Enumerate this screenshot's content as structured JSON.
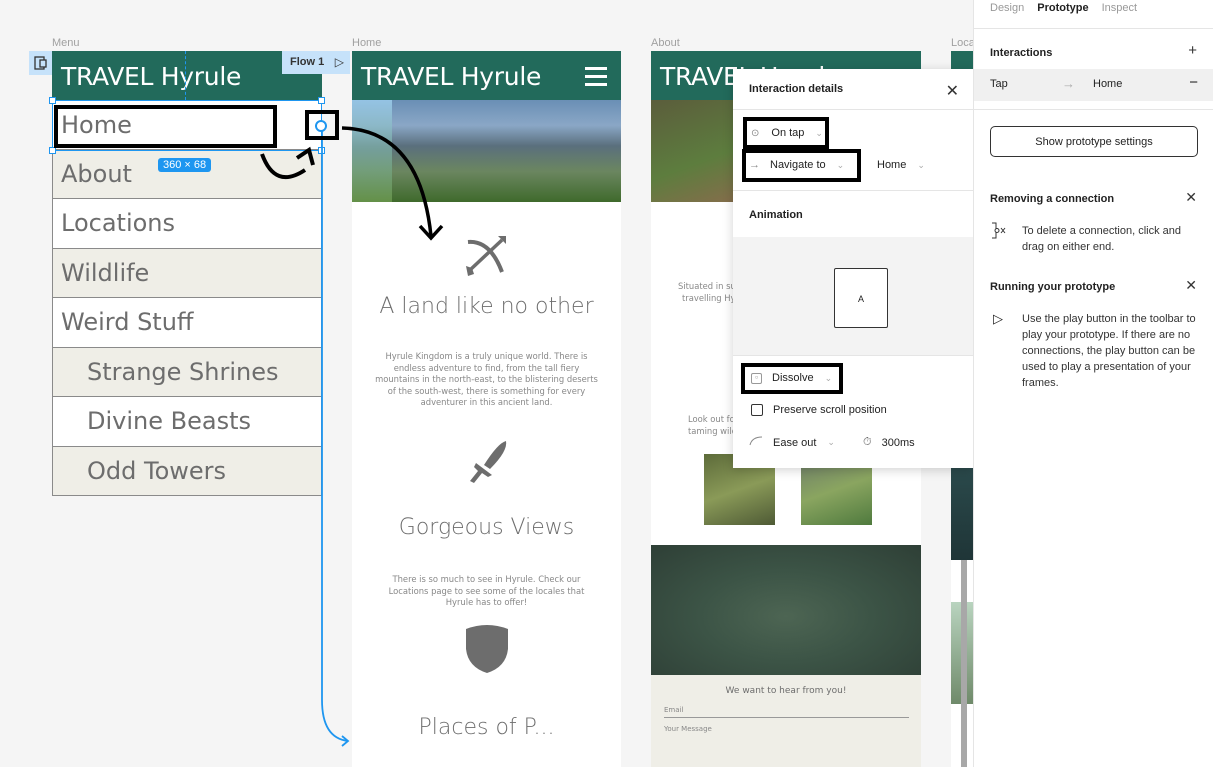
{
  "canvas": {
    "frames": {
      "menu_label": "Menu",
      "home_label": "Home",
      "about_label": "About",
      "locations_label": "Loca"
    },
    "flow_tag": "Flow 1",
    "selection_size": "360 × 68",
    "accent_color": "#1e96f0",
    "header_color": "#226a5b"
  },
  "menu": {
    "brand": "TRAVEL Hyrule",
    "items": [
      {
        "label": "Home"
      },
      {
        "label": "About"
      },
      {
        "label": "Locations"
      },
      {
        "label": "Wildlife"
      },
      {
        "label": "Weird Stuff"
      },
      {
        "label": "Strange Shrines"
      },
      {
        "label": "Divine Beasts"
      },
      {
        "label": "Odd Towers"
      }
    ]
  },
  "home": {
    "brand": "TRAVEL Hyrule",
    "sections": [
      {
        "icon": "bow-arrow-icon",
        "title": "A land like no other",
        "body": "Hyrule Kingdom is a truly unique world. There is endless adventure to find, from the tall fiery mountains in the north-east, to the blistering deserts of the south-west, there is something for every adventurer in this ancient land."
      },
      {
        "icon": "sword-icon",
        "title": "Gorgeous Views",
        "body": "There is so much to see in Hyrule. Check our Locations page to see some of the locales that Hyrule has to offer!"
      },
      {
        "icon": "shield-icon",
        "title": "Places of P..."
      }
    ]
  },
  "about": {
    "brand": "TRAVEL Hyrule",
    "snippet1_line1": "Situated in su",
    "snippet1_line2": "travelling Hy",
    "snippet2_line1": "Look out fo",
    "snippet2_line2": "taming wild",
    "contact": {
      "title": "We want to hear from you!",
      "email_placeholder": "Email",
      "message_placeholder": "Your Message"
    }
  },
  "popover": {
    "title": "Interaction details",
    "trigger": "On tap",
    "action": "Navigate to",
    "destination": "Home",
    "animation_title": "Animation",
    "preview_letter": "A",
    "animation_type": "Dissolve",
    "preserve_scroll_label": "Preserve scroll position",
    "preserve_scroll_checked": false,
    "easing": "Ease out",
    "duration": "300ms"
  },
  "panel": {
    "tabs": [
      {
        "label": "Design",
        "active": false
      },
      {
        "label": "Prototype",
        "active": true
      },
      {
        "label": "Inspect",
        "active": false
      }
    ],
    "interactions_title": "Interactions",
    "interaction": {
      "trigger": "Tap",
      "destination": "Home"
    },
    "settings_button": "Show prototype settings",
    "tips": [
      {
        "title": "Removing a connection",
        "text": "To delete a connection, click and drag on either end."
      },
      {
        "title": "Running your prototype",
        "text": "Use the play button in the toolbar to play your prototype. If there are no connections, the play button can be used to play a presentation of your frames."
      }
    ]
  }
}
